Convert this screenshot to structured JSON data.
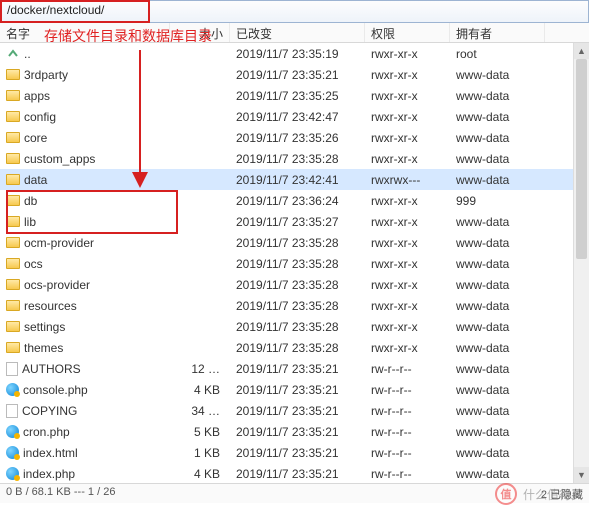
{
  "path": "/docker/nextcloud/",
  "annotation_text": "存储文件目录和数据库目录",
  "columns": {
    "name": "名字",
    "size": "大小",
    "modified": "已改变",
    "perm": "权限",
    "owner": "拥有者"
  },
  "watermark": {
    "label": "值",
    "text": "什么值得买"
  },
  "status": "0 B / 68.1 KB --- 1 / 26",
  "hidden_count": "2 已隐藏",
  "rows": [
    {
      "icon": "up",
      "name": "..",
      "size": "",
      "modified": "2019/11/7 23:35:19",
      "perm": "rwxr-xr-x",
      "owner": "root",
      "sel": false
    },
    {
      "icon": "folder",
      "name": "3rdparty",
      "size": "",
      "modified": "2019/11/7 23:35:21",
      "perm": "rwxr-xr-x",
      "owner": "www-data",
      "sel": false
    },
    {
      "icon": "folder",
      "name": "apps",
      "size": "",
      "modified": "2019/11/7 23:35:25",
      "perm": "rwxr-xr-x",
      "owner": "www-data",
      "sel": false
    },
    {
      "icon": "folder",
      "name": "config",
      "size": "",
      "modified": "2019/11/7 23:42:47",
      "perm": "rwxr-xr-x",
      "owner": "www-data",
      "sel": false
    },
    {
      "icon": "folder",
      "name": "core",
      "size": "",
      "modified": "2019/11/7 23:35:26",
      "perm": "rwxr-xr-x",
      "owner": "www-data",
      "sel": false
    },
    {
      "icon": "folder",
      "name": "custom_apps",
      "size": "",
      "modified": "2019/11/7 23:35:28",
      "perm": "rwxr-xr-x",
      "owner": "www-data",
      "sel": false
    },
    {
      "icon": "folder",
      "name": "data",
      "size": "",
      "modified": "2019/11/7 23:42:41",
      "perm": "rwxrwx---",
      "owner": "www-data",
      "sel": true
    },
    {
      "icon": "folder",
      "name": "db",
      "size": "",
      "modified": "2019/11/7 23:36:24",
      "perm": "rwxr-xr-x",
      "owner": "999",
      "sel": false
    },
    {
      "icon": "folder",
      "name": "lib",
      "size": "",
      "modified": "2019/11/7 23:35:27",
      "perm": "rwxr-xr-x",
      "owner": "www-data",
      "sel": false
    },
    {
      "icon": "folder",
      "name": "ocm-provider",
      "size": "",
      "modified": "2019/11/7 23:35:28",
      "perm": "rwxr-xr-x",
      "owner": "www-data",
      "sel": false
    },
    {
      "icon": "folder",
      "name": "ocs",
      "size": "",
      "modified": "2019/11/7 23:35:28",
      "perm": "rwxr-xr-x",
      "owner": "www-data",
      "sel": false
    },
    {
      "icon": "folder",
      "name": "ocs-provider",
      "size": "",
      "modified": "2019/11/7 23:35:28",
      "perm": "rwxr-xr-x",
      "owner": "www-data",
      "sel": false
    },
    {
      "icon": "folder",
      "name": "resources",
      "size": "",
      "modified": "2019/11/7 23:35:28",
      "perm": "rwxr-xr-x",
      "owner": "www-data",
      "sel": false
    },
    {
      "icon": "folder",
      "name": "settings",
      "size": "",
      "modified": "2019/11/7 23:35:28",
      "perm": "rwxr-xr-x",
      "owner": "www-data",
      "sel": false
    },
    {
      "icon": "folder",
      "name": "themes",
      "size": "",
      "modified": "2019/11/7 23:35:28",
      "perm": "rwxr-xr-x",
      "owner": "www-data",
      "sel": false
    },
    {
      "icon": "file",
      "name": "AUTHORS",
      "size": "12 …",
      "modified": "2019/11/7 23:35:21",
      "perm": "rw-r--r--",
      "owner": "www-data",
      "sel": false
    },
    {
      "icon": "php",
      "name": "console.php",
      "size": "4 KB",
      "modified": "2019/11/7 23:35:21",
      "perm": "rw-r--r--",
      "owner": "www-data",
      "sel": false
    },
    {
      "icon": "file",
      "name": "COPYING",
      "size": "34 …",
      "modified": "2019/11/7 23:35:21",
      "perm": "rw-r--r--",
      "owner": "www-data",
      "sel": false
    },
    {
      "icon": "php",
      "name": "cron.php",
      "size": "5 KB",
      "modified": "2019/11/7 23:35:21",
      "perm": "rw-r--r--",
      "owner": "www-data",
      "sel": false
    },
    {
      "icon": "php",
      "name": "index.html",
      "size": "1 KB",
      "modified": "2019/11/7 23:35:21",
      "perm": "rw-r--r--",
      "owner": "www-data",
      "sel": false
    },
    {
      "icon": "php",
      "name": "index.php",
      "size": "4 KB",
      "modified": "2019/11/7 23:35:21",
      "perm": "rw-r--r--",
      "owner": "www-data",
      "sel": false
    }
  ]
}
